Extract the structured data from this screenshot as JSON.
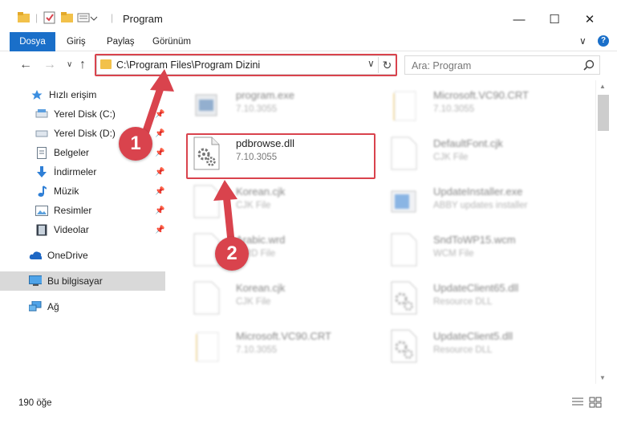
{
  "window": {
    "title": "Program",
    "minimize": "—",
    "maximize": "☐",
    "close": "✕"
  },
  "ribbon": {
    "tabs": [
      "Dosya",
      "Giriş",
      "Paylaş",
      "Görünüm"
    ],
    "expand": "∨",
    "help": "?"
  },
  "nav": {
    "back": "←",
    "forward": "→",
    "recent": "∨",
    "up": "↑",
    "address": "C:\\Program Files\\Program Dizini",
    "dropdown": "∨",
    "refresh": "↻",
    "search_placeholder": "Ara: Program"
  },
  "sidebar": {
    "items": [
      {
        "label": "Hızlı erişim",
        "icon": "star-icon",
        "pinned": false
      },
      {
        "label": "Yerel Disk (C:)",
        "icon": "drive-icon",
        "pinned": true
      },
      {
        "label": "Yerel Disk (D:)",
        "icon": "drive-icon",
        "pinned": true
      },
      {
        "label": "Belgeler",
        "icon": "documents-icon",
        "pinned": true
      },
      {
        "label": "İndirmeler",
        "icon": "download-icon",
        "pinned": true
      },
      {
        "label": "Müzik",
        "icon": "music-icon",
        "pinned": true
      },
      {
        "label": "Resimler",
        "icon": "pictures-icon",
        "pinned": true
      },
      {
        "label": "Videolar",
        "icon": "videos-icon",
        "pinned": true
      },
      {
        "label": "OneDrive",
        "icon": "cloud-icon",
        "pinned": false
      },
      {
        "label": "Bu bilgisayar",
        "icon": "computer-icon",
        "pinned": false,
        "selected": true
      },
      {
        "label": "Ağ",
        "icon": "network-icon",
        "pinned": false
      }
    ],
    "pin_glyph": "📌"
  },
  "files": {
    "left": [
      {
        "name": "program.exe",
        "sub": "7.10.3055",
        "type": "exe",
        "blurred": true
      },
      {
        "name": "pdbrowse.dll",
        "sub": "7.10.3055",
        "type": "dll",
        "blurred": false
      },
      {
        "name": "Korean.cjk",
        "sub": "CJK File",
        "type": "blank",
        "blurred": true
      },
      {
        "name": "Arabic.wrd",
        "sub": "WRD File",
        "type": "blank",
        "blurred": true
      },
      {
        "name": "Korean.cjk",
        "sub": "CJK File",
        "type": "blank",
        "blurred": true
      },
      {
        "name": "Microsoft.VC90.CRT",
        "sub": "7.10.3055",
        "type": "folder",
        "blurred": true
      }
    ],
    "right": [
      {
        "name": "Microsoft.VC90.CRT",
        "sub": "7.10.3055",
        "type": "folder",
        "blurred": true
      },
      {
        "name": "DefaultFont.cjk",
        "sub": "CJK File",
        "type": "blank",
        "blurred": true
      },
      {
        "name": "UpdateInstaller.exe",
        "sub": "ABBY updates installer",
        "type": "installer",
        "blurred": true
      },
      {
        "name": "SndToWP15.wcm",
        "sub": "WCM File",
        "type": "blank",
        "blurred": true
      },
      {
        "name": "UpdateClient65.dll",
        "sub": "Resource DLL",
        "type": "dll",
        "blurred": true
      },
      {
        "name": "UpdateClient5.dll",
        "sub": "Resource DLL",
        "type": "dll",
        "blurred": true
      }
    ]
  },
  "status": {
    "count": "190 öğe"
  },
  "annotations": {
    "step1": "1",
    "step2": "2",
    "accent": "#d9434d"
  }
}
